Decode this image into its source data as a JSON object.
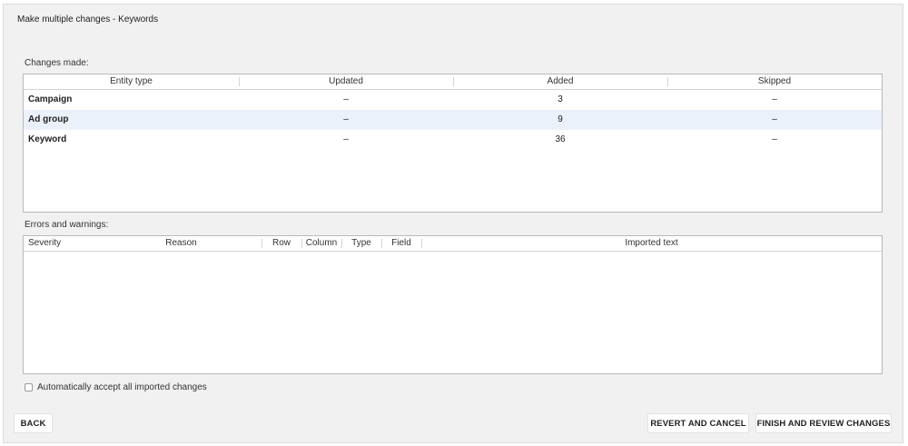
{
  "dialog": {
    "title": "Make multiple changes - Keywords"
  },
  "changes": {
    "label": "Changes made:",
    "columns": [
      "Entity type",
      "Updated",
      "Added",
      "Skipped"
    ],
    "rows": [
      {
        "entity": "Campaign",
        "updated": "–",
        "added": "3",
        "skipped": "–"
      },
      {
        "entity": "Ad group",
        "updated": "–",
        "added": "9",
        "skipped": "–"
      },
      {
        "entity": "Keyword",
        "updated": "–",
        "added": "36",
        "skipped": "–"
      }
    ]
  },
  "errors": {
    "label": "Errors and warnings:",
    "columns": [
      "Severity",
      "Reason",
      "Row",
      "Column",
      "Type",
      "Field",
      "Imported text"
    ]
  },
  "auto_accept": {
    "label": "Automatically accept all imported changes",
    "checked": false
  },
  "buttons": {
    "back": "BACK",
    "revert": "REVERT AND CANCEL",
    "finish": "FINISH AND REVIEW CHANGES"
  },
  "colors": {
    "selected_row": "#ebf1fb",
    "background": "#f1f1f1"
  }
}
